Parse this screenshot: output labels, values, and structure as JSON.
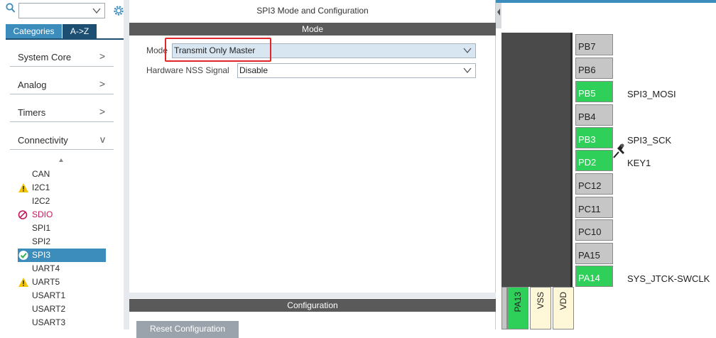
{
  "left_panel": {
    "search_value": "",
    "tabs": {
      "categories": "Categories",
      "az": "A->Z"
    },
    "categories": [
      {
        "label": "System Core",
        "chevron": ">"
      },
      {
        "label": "Analog",
        "chevron": ">"
      },
      {
        "label": "Timers",
        "chevron": ">"
      },
      {
        "label": "Connectivity",
        "chevron": "v"
      }
    ],
    "peripherals": [
      {
        "label": "CAN",
        "status": "none"
      },
      {
        "label": "I2C1",
        "status": "warning"
      },
      {
        "label": "I2C2",
        "status": "none"
      },
      {
        "label": "SDIO",
        "status": "error"
      },
      {
        "label": "SPI1",
        "status": "none"
      },
      {
        "label": "SPI2",
        "status": "none"
      },
      {
        "label": "SPI3",
        "status": "ok-selected"
      },
      {
        "label": "UART4",
        "status": "none"
      },
      {
        "label": "UART5",
        "status": "warning"
      },
      {
        "label": "USART1",
        "status": "none"
      },
      {
        "label": "USART2",
        "status": "none"
      },
      {
        "label": "USART3",
        "status": "none"
      }
    ]
  },
  "center_panel": {
    "title": "SPI3 Mode and Configuration",
    "mode_header": "Mode",
    "mode_label": "Mode",
    "mode_value": "Transmit Only Master",
    "nss_label": "Hardware NSS Signal",
    "nss_value": "Disable",
    "config_header": "Configuration",
    "reset_button": "Reset Configuration"
  },
  "chip": {
    "pins": [
      {
        "name": "PB7",
        "color": "gray",
        "signal": ""
      },
      {
        "name": "PB6",
        "color": "gray",
        "signal": ""
      },
      {
        "name": "PB5",
        "color": "green",
        "signal": "SPI3_MOSI"
      },
      {
        "name": "PB4",
        "color": "gray",
        "signal": ""
      },
      {
        "name": "PB3",
        "color": "green",
        "signal": "SPI3_SCK"
      },
      {
        "name": "PD2",
        "color": "green",
        "signal": "KEY1"
      },
      {
        "name": "PC12",
        "color": "gray",
        "signal": ""
      },
      {
        "name": "PC11",
        "color": "gray",
        "signal": ""
      },
      {
        "name": "PC10",
        "color": "gray",
        "signal": ""
      },
      {
        "name": "PA15",
        "color": "gray",
        "signal": ""
      },
      {
        "name": "PA14",
        "color": "green",
        "signal": "SYS_JTCK-SWCLK"
      }
    ],
    "bottom_pins": [
      {
        "name": "PA13",
        "color": "green"
      },
      {
        "name": "VSS",
        "color": "yellow"
      },
      {
        "name": "VDD",
        "color": "yellow"
      }
    ]
  },
  "colors": {
    "accent": "#3c8dbc",
    "pin_green": "#2fd05a",
    "pin_gray": "#c6c6c6",
    "highlight_red": "#e0262b"
  }
}
